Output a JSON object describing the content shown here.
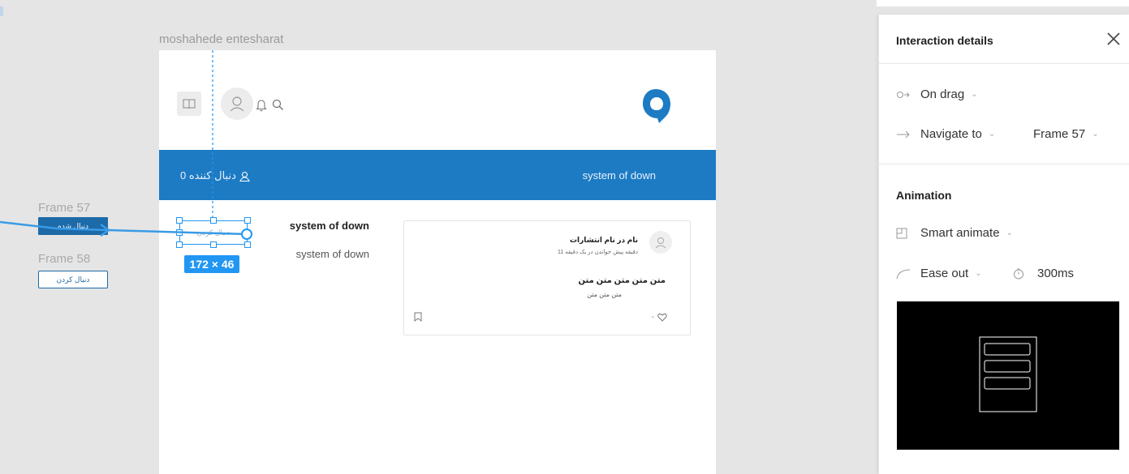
{
  "canvas": {
    "frame_title": "moshahede entesharat",
    "side_frames": [
      {
        "label": "Frame 57",
        "button_label": "دنبال شده"
      },
      {
        "label": "Frame 58",
        "button_label": "دنبال کردن"
      }
    ]
  },
  "app": {
    "banner_title": "system of down",
    "followers_label": "0 دنبال کننده",
    "follow_button_label": "دنبال کردن",
    "selection_size": "172 × 46",
    "profile_name": "system of down",
    "profile_subtitle": "system of down",
    "card": {
      "author": "نام در نام انتشارات",
      "meta": "11 دقیقه پیش خواندن در یک دقیقه",
      "title": "متن متن متن متن متن",
      "body": "متن متن متن",
      "like_count": "-"
    }
  },
  "panel": {
    "title": "Interaction details",
    "trigger": "On drag",
    "action": "Navigate to",
    "destination": "Frame 57",
    "animation_title": "Animation",
    "animation_type": "Smart animate",
    "easing": "Ease out",
    "duration": "300ms"
  },
  "colors": {
    "brand": "#1d7bc4",
    "selection": "#2196f3",
    "panel_bg": "#ffffff",
    "canvas_bg": "#e5e5e5"
  }
}
